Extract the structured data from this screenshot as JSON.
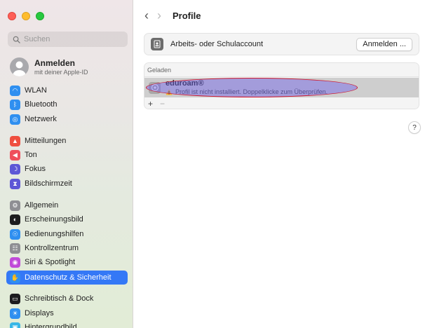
{
  "sidebar": {
    "search_placeholder": "Suchen",
    "apple_id": {
      "title": "Anmelden",
      "subtitle": "mit deiner Apple-ID"
    },
    "items": [
      {
        "label": "WLAN",
        "icon": "wifi-icon",
        "color": "#2f8ff0"
      },
      {
        "label": "Bluetooth",
        "icon": "bluetooth-icon",
        "color": "#2f8ff0"
      },
      {
        "label": "Netzwerk",
        "icon": "globe-icon",
        "color": "#2f8ff0"
      },
      {
        "label": "Mitteilungen",
        "icon": "bell-icon",
        "color": "#ef4f3f"
      },
      {
        "label": "Ton",
        "icon": "speaker-icon",
        "color": "#ef4f5b"
      },
      {
        "label": "Fokus",
        "icon": "moon-icon",
        "color": "#5d57d6"
      },
      {
        "label": "Bildschirmzeit",
        "icon": "hourglass-icon",
        "color": "#5d57d6"
      },
      {
        "label": "Allgemein",
        "icon": "gear-icon",
        "color": "#8e8e93"
      },
      {
        "label": "Erscheinungsbild",
        "icon": "appearance-icon",
        "color": "#1c1c1e"
      },
      {
        "label": "Bedienungshilfen",
        "icon": "accessibility-icon",
        "color": "#2f8ff0"
      },
      {
        "label": "Kontrollzentrum",
        "icon": "control-center-icon",
        "color": "#8e8e93"
      },
      {
        "label": "Siri & Spotlight",
        "icon": "siri-icon",
        "color": "#c04ad8"
      },
      {
        "label": "Datenschutz & Sicherheit",
        "icon": "hand-icon",
        "color": "#2f8ff0"
      },
      {
        "label": "Schreibtisch & Dock",
        "icon": "dock-icon",
        "color": "#1c1c1e"
      },
      {
        "label": "Displays",
        "icon": "sun-icon",
        "color": "#2f8ff0"
      },
      {
        "label": "Hintergrundbild",
        "icon": "wallpaper-icon",
        "color": "#39b7e6"
      }
    ],
    "active_index": 12
  },
  "main": {
    "title": "Profile",
    "account": {
      "label": "Arbeits- oder Schulaccount",
      "button": "Anmelden ..."
    },
    "section_header": "Geladen",
    "profile": {
      "name": "eduroam®",
      "warning": "Profil ist nicht installiert. Doppelklicke zum Überprüfen."
    },
    "add_label": "+",
    "remove_label": "−",
    "help_label": "?"
  }
}
